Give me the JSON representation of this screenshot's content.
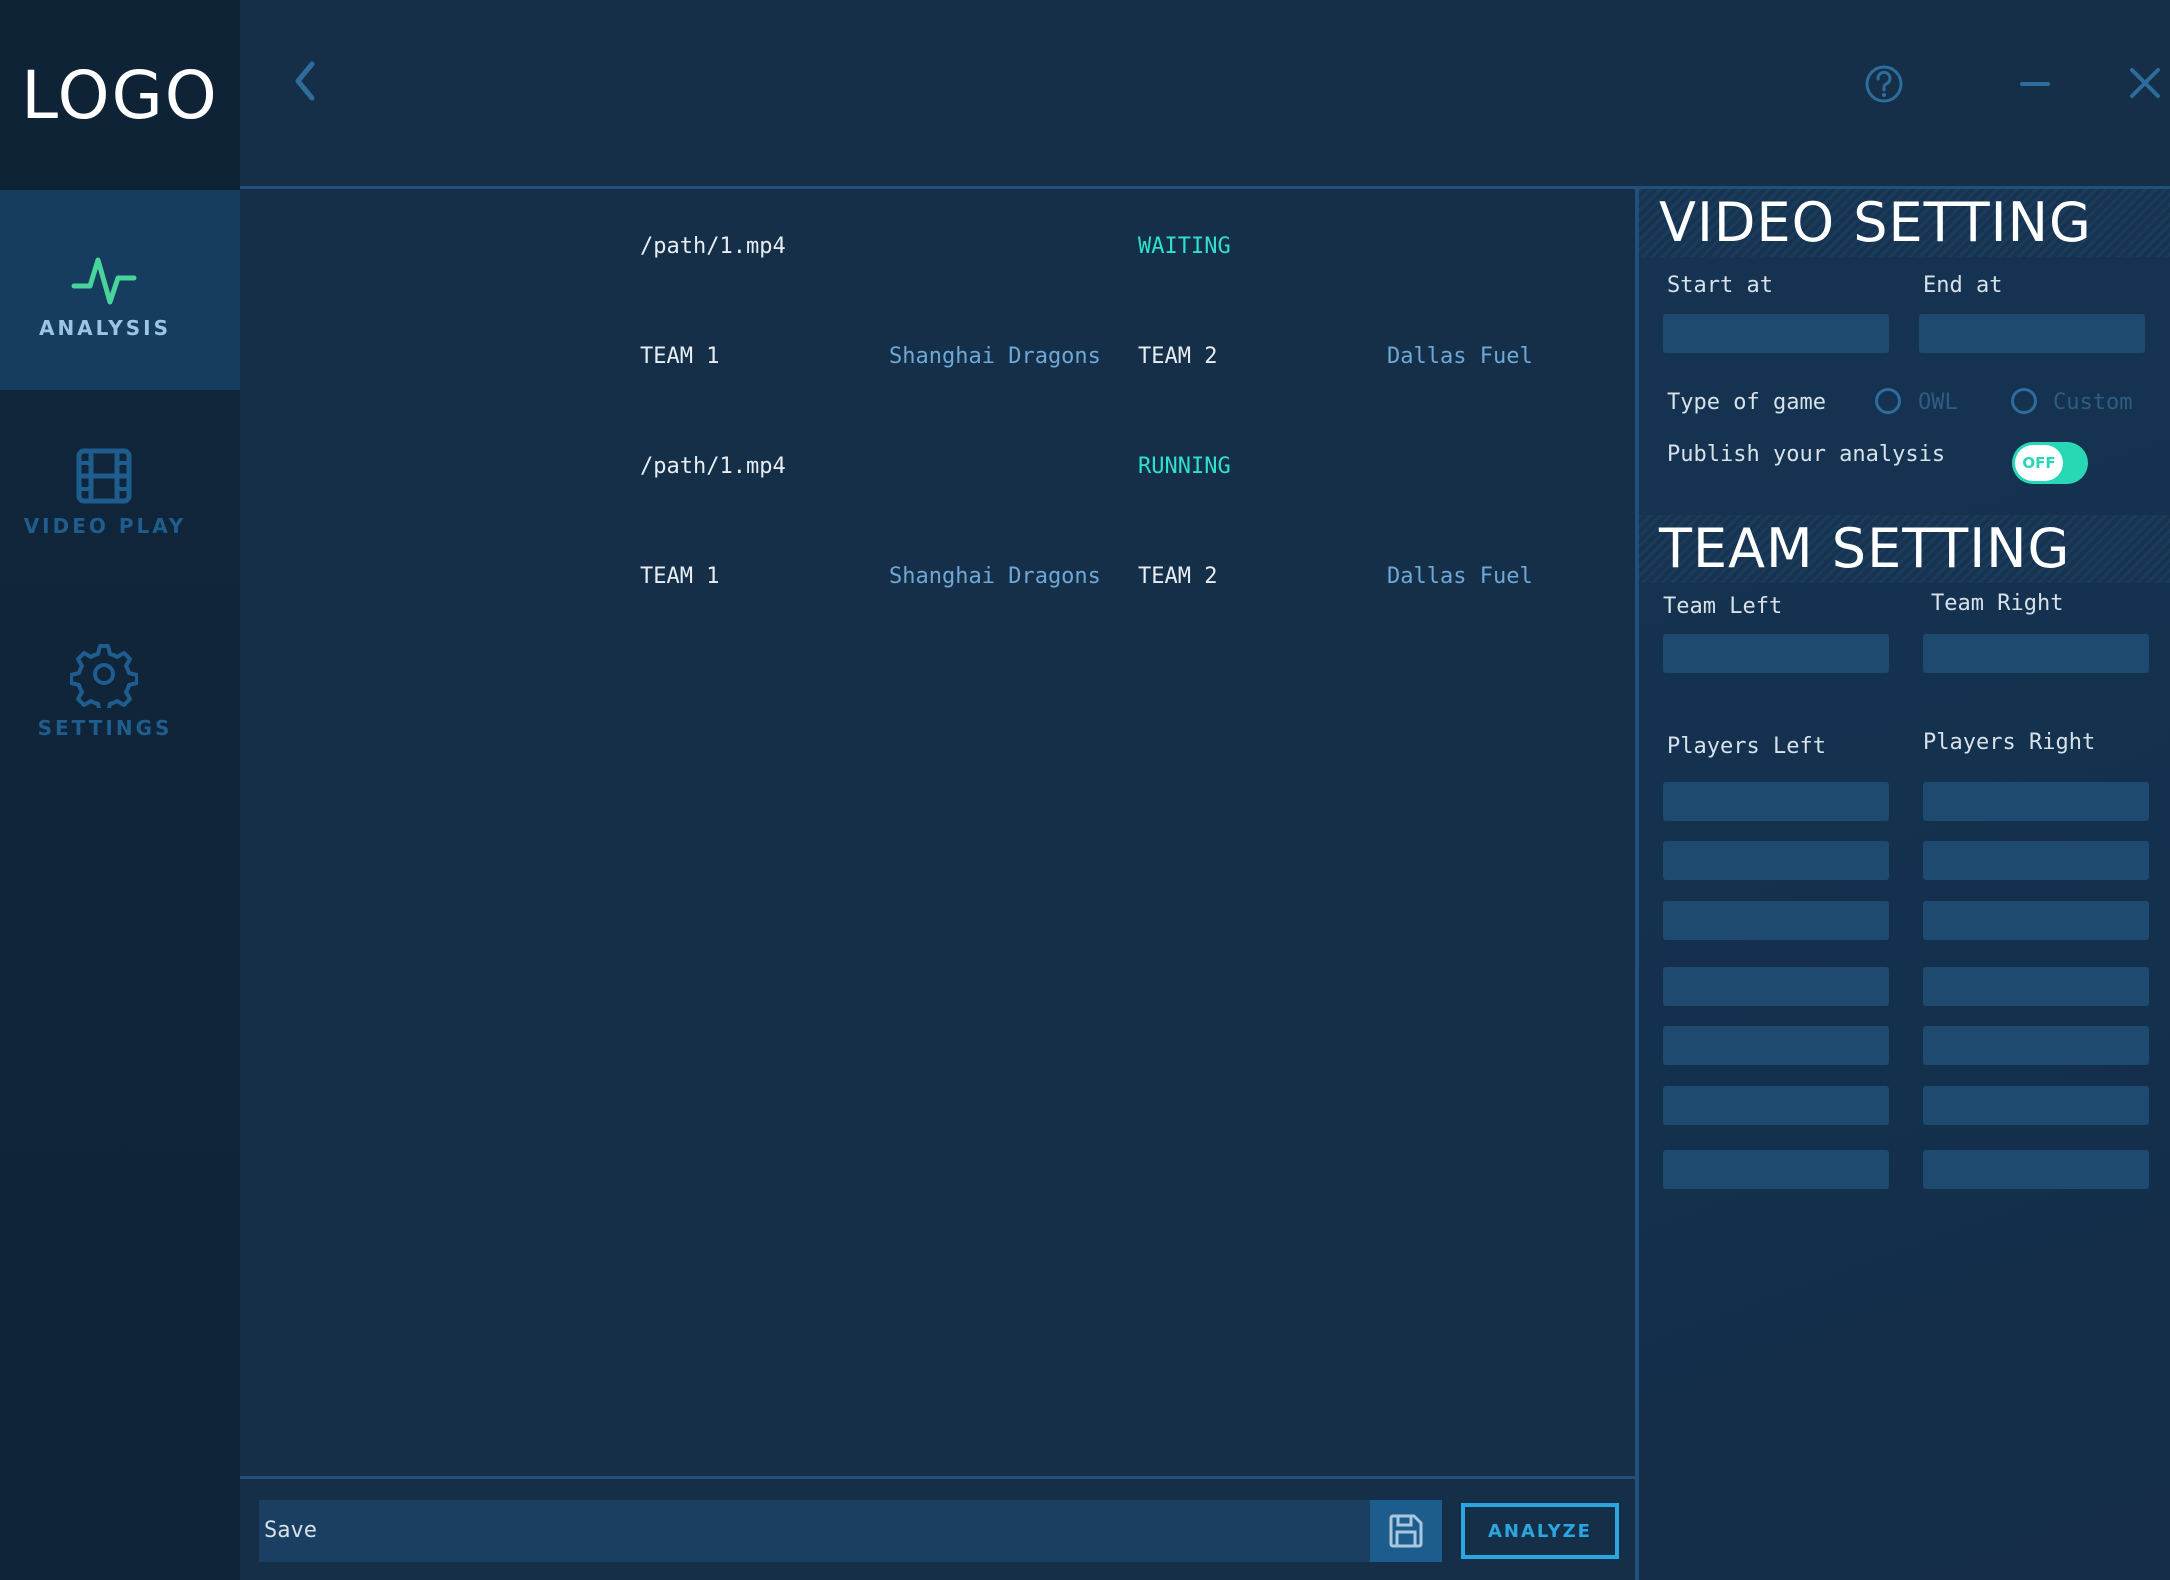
{
  "logo": "LOGO",
  "nav": [
    {
      "label": "ANALYSIS",
      "icon": "pulse-icon",
      "active": true
    },
    {
      "label": "VIDEO PLAY",
      "icon": "film-icon",
      "active": false
    },
    {
      "label": "SETTINGS",
      "icon": "gear-icon",
      "active": false
    }
  ],
  "topbar": {
    "back_icon": "chevron-left-icon",
    "help_icon": "help-circle-icon",
    "minimize_icon": "minimize-icon",
    "close_icon": "close-icon"
  },
  "jobs": [
    {
      "path": "/path/1.mp4",
      "status": "WAITING",
      "team1_label": "TEAM 1",
      "team1_name": "Shanghai Dragons",
      "team2_label": "TEAM 2",
      "team2_name": "Dallas Fuel"
    },
    {
      "path": "/path/1.mp4",
      "status": "RUNNING",
      "team1_label": "TEAM 1",
      "team1_name": "Shanghai Dragons",
      "team2_label": "TEAM 2",
      "team2_name": "Dallas Fuel"
    }
  ],
  "video_setting": {
    "title": "VIDEO SETTING",
    "start_label": "Start at",
    "end_label": "End at",
    "start_value": "",
    "end_value": "",
    "game_type_label": "Type of game",
    "game_type_options": [
      "OWL",
      "Custom"
    ],
    "publish_label": "Publish your analysis",
    "publish_toggle": "OFF"
  },
  "team_setting": {
    "title": "TEAM SETTING",
    "team_left_label": "Team Left",
    "team_right_label": "Team Right",
    "players_left_label": "Players Left",
    "players_right_label": "Players Right"
  },
  "footer": {
    "save_label": "Save",
    "save_icon": "floppy-disk-icon",
    "analyze_label": "ANALYZE"
  },
  "colors": {
    "background": "#152f49",
    "sidebar": "#10263a",
    "accent_cyan": "#2fe0cf",
    "accent_blue": "#2aa7e0",
    "toggle": "#28d7b5"
  }
}
